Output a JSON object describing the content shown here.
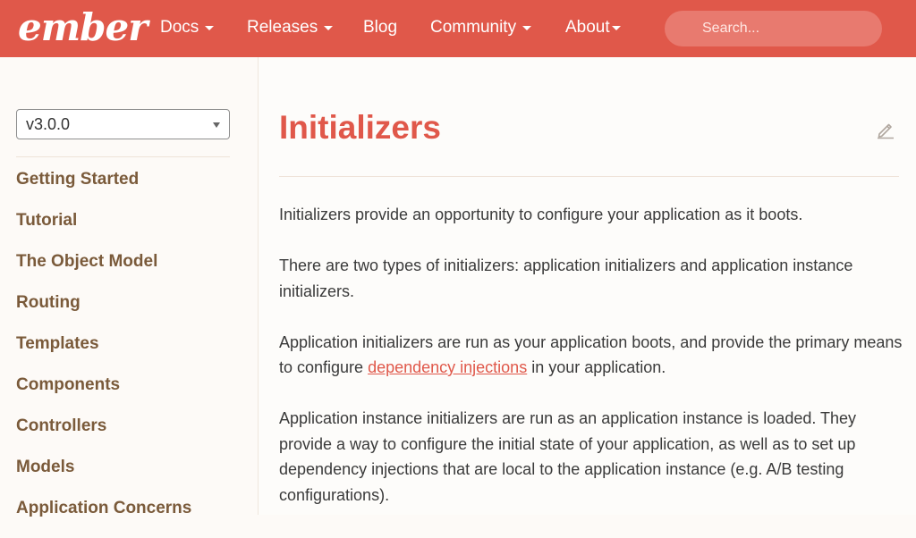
{
  "header": {
    "logo_text": "ember",
    "nav": [
      {
        "label": "Docs",
        "has_dropdown": true
      },
      {
        "label": "Releases",
        "has_dropdown": true
      },
      {
        "label": "Blog",
        "has_dropdown": false
      },
      {
        "label": "Community",
        "has_dropdown": true
      },
      {
        "label": "About",
        "has_dropdown": true
      }
    ],
    "search_placeholder": "Search...",
    "brand_color": "#e0584a"
  },
  "sidebar": {
    "version": "v3.0.0",
    "items": [
      {
        "label": "Getting Started"
      },
      {
        "label": "Tutorial"
      },
      {
        "label": "The Object Model"
      },
      {
        "label": "Routing"
      },
      {
        "label": "Templates"
      },
      {
        "label": "Components"
      },
      {
        "label": "Controllers"
      },
      {
        "label": "Models"
      },
      {
        "label": "Application Concerns"
      }
    ]
  },
  "main": {
    "title": "Initializers",
    "edit_icon": "pencil-icon",
    "paragraphs": {
      "p1": "Initializers provide an opportunity to configure your application as it boots.",
      "p2": "There are two types of initializers: application initializers and application instance initializers.",
      "p3_before": "Application initializers are run as your application boots, and provide the primary means to configure ",
      "p3_link": "dependency injections",
      "p3_after": " in your application.",
      "p4": "Application instance initializers are run as an application instance is loaded. They provide a way to configure the initial state of your application, as well as to set up dependency injections that are local to the application instance (e.g. A/B testing configurations)."
    }
  }
}
